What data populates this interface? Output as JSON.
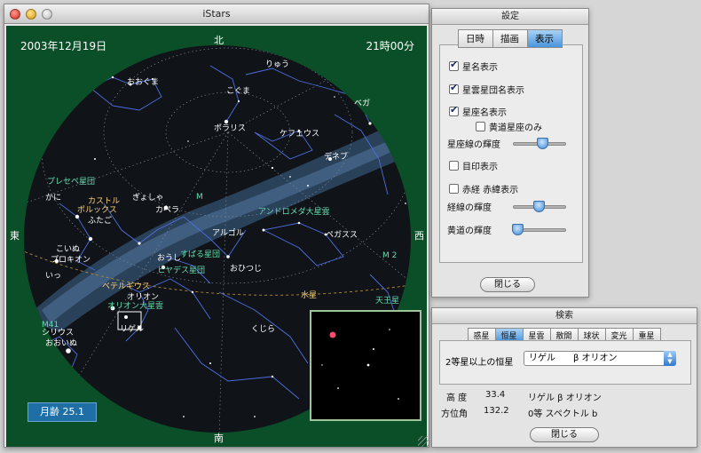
{
  "main_window": {
    "title": "iStars",
    "date": "2003年12月19日",
    "time": "21時00分",
    "moon_age": "月齢 25.1",
    "directions": {
      "north": "北",
      "south": "南",
      "east": "東",
      "west": "西"
    },
    "sky_labels": [
      {
        "text": "おおぐま",
        "color": "#ffffff"
      },
      {
        "text": "こぐま",
        "color": "#ffffff"
      },
      {
        "text": "りゅう",
        "color": "#ffffff"
      },
      {
        "text": "ベガ",
        "color": "#ffffff"
      },
      {
        "text": "ポラリス",
        "color": "#ffffff"
      },
      {
        "text": "ケフェウス",
        "color": "#ffffff"
      },
      {
        "text": "デネブ",
        "color": "#ffffff"
      },
      {
        "text": "プレセペ星団",
        "color": "#63e0b0"
      },
      {
        "text": "かに",
        "color": "#ffffff"
      },
      {
        "text": "カストル",
        "color": "#ffd27a"
      },
      {
        "text": "ポルックス",
        "color": "#ffd27a"
      },
      {
        "text": "ふたご",
        "color": "#ffffff"
      },
      {
        "text": "ぎょしゃ",
        "color": "#ffffff"
      },
      {
        "text": "カペラ",
        "color": "#ffffff"
      },
      {
        "text": "M",
        "color": "#63e0b0"
      },
      {
        "text": "アンドロメダ大星雲",
        "color": "#63e0b0"
      },
      {
        "text": "アルゴル",
        "color": "#ffffff"
      },
      {
        "text": "ペガスス",
        "color": "#ffffff"
      },
      {
        "text": "こいぬ",
        "color": "#ffffff"
      },
      {
        "text": "プロキオン",
        "color": "#ffffff"
      },
      {
        "text": "いっ",
        "color": "#ffffff"
      },
      {
        "text": "おうし",
        "color": "#ffffff"
      },
      {
        "text": "すばる星団",
        "color": "#63e0b0"
      },
      {
        "text": "ヒヤデス星団",
        "color": "#63e0b0"
      },
      {
        "text": "おひつじ",
        "color": "#ffffff"
      },
      {
        "text": "M 2",
        "color": "#63e0b0"
      },
      {
        "text": "ベテルギウス",
        "color": "#ffd27a"
      },
      {
        "text": "オリオン",
        "color": "#ffffff"
      },
      {
        "text": "オリオン大星雲",
        "color": "#63e0b0"
      },
      {
        "text": "リゲル",
        "color": "#ffffff"
      },
      {
        "text": "シリウス",
        "color": "#ffffff"
      },
      {
        "text": "おおいぬ",
        "color": "#ffffff"
      },
      {
        "text": "くじら",
        "color": "#ffffff"
      },
      {
        "text": "水星",
        "color": "#ffd27a"
      },
      {
        "text": "天王星",
        "color": "#63e0b0"
      },
      {
        "text": "M41",
        "color": "#63e0b0"
      }
    ]
  },
  "settings_window": {
    "title": "設定",
    "tabs": [
      "日時",
      "描画",
      "表示"
    ],
    "active_tab": "表示",
    "options": [
      {
        "label": "星名表示",
        "checked": true
      },
      {
        "label": "星雲星団名表示",
        "checked": true
      },
      {
        "label": "星座名表示",
        "checked": true
      },
      {
        "label": "黄道星座のみ",
        "checked": false
      },
      {
        "label": "目印表示",
        "checked": false
      },
      {
        "label": "赤経 赤緯表示",
        "checked": false
      }
    ],
    "sliders": [
      {
        "label": "星座線の輝度",
        "value": 0.55
      },
      {
        "label": "経線の輝度",
        "value": 0.45
      },
      {
        "label": "黄道の輝度",
        "value": 0.05
      }
    ],
    "close_label": "閉じる"
  },
  "search_window": {
    "title": "検索",
    "tabs": [
      "惑星",
      "恒星",
      "星雲",
      "散開",
      "球状",
      "変光",
      "重星"
    ],
    "active_tab": "恒星",
    "filter_label": "2等星以上の恒星",
    "selected_star": "リゲル　　β オリオン",
    "altitude_label": "高 度",
    "altitude_value": "33.4",
    "azimuth_label": "方位角",
    "azimuth_value": "132.2",
    "star_name": "リゲル β オリオン",
    "star_info": "0等 スペクトル b",
    "close_label": "閉じる"
  },
  "colors": {
    "sky_background": "#0b4f28",
    "sky_disk": "#101318",
    "milky_way": "#3a5470",
    "constellation_lines": "#4d6ee0",
    "accent": "#4a95dd"
  }
}
